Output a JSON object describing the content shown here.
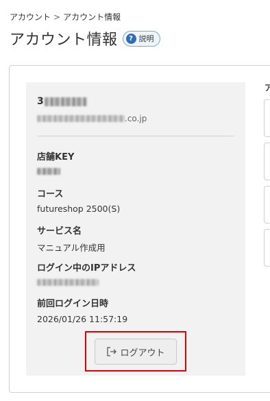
{
  "breadcrumb": {
    "items": [
      "アカウント",
      "アカウント情報"
    ],
    "separator": ">"
  },
  "page": {
    "title": "アカウント情報",
    "help_label": "説明",
    "help_icon_glyph": "?"
  },
  "account": {
    "shop_name_prefix": "3",
    "email_suffix": ".co.jp",
    "divider": true
  },
  "fields": {
    "store_key_label": "店舗KEY",
    "course_label": "コース",
    "course_value": "futureshop 2500(S)",
    "service_name_label": "サービス名",
    "service_name_value": "マニュアル作成用",
    "ip_label": "ログイン中のIPアドレス",
    "last_login_label": "前回ログイン日時",
    "last_login_value": "2026/01/26 11:57:19"
  },
  "actions": {
    "logout_label": "ログアウト",
    "logout_icon": "logout-icon"
  },
  "right_panel": {
    "heading": "ア"
  },
  "colors": {
    "highlight": "#e00000",
    "help_icon": "#2f6fb5",
    "panel_bg": "#f2f2f2"
  }
}
